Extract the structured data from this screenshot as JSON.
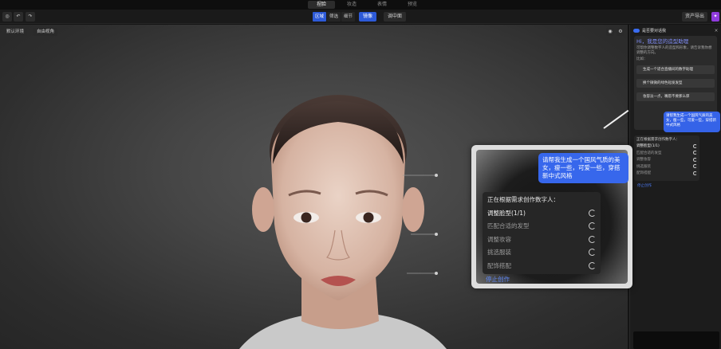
{
  "top_tabs": [
    {
      "label": "捏脸",
      "active": true
    },
    {
      "label": "妆造",
      "active": false
    },
    {
      "label": "表情",
      "active": false
    },
    {
      "label": "预览",
      "active": false
    }
  ],
  "toolbar": {
    "undo_icon": "undo-icon",
    "redo_icon": "redo-icon",
    "segments": [
      "区域",
      "筛选",
      "细节"
    ],
    "active_segment": "区域",
    "mirror_label": "镜像",
    "view_label": "调中面",
    "export_label": "资产导出",
    "accent": "#2d5ad8"
  },
  "viewport": {
    "env_label": "默认环境",
    "camera_label": "自由视角",
    "eye_icon": "eye-icon",
    "settings_icon": "gear-icon"
  },
  "chat": {
    "header": "是否要对话我",
    "greeting_title": "Hi，我是您的造型助理",
    "greeting_desc": "可帮你调整数字人的造型和形象，请告诉我你想调整的方向。",
    "examples_label": "比如：",
    "suggestions": [
      "生成一个适合直播间的数字助理",
      "换个微微的绿色短发发型",
      "妆容淡一点，嘴唇不要那么厚"
    ],
    "user_message": "请帮我生成一个国风气质的美女，瘦一些，可爱一些，穿搭新中式风格",
    "status_title": "正在根据需求创作数字人：",
    "steps": [
      "调整脸型(1/1)",
      "匹配合适的发型",
      "调整妆容",
      "挑选服装",
      "配饰搭配"
    ],
    "stop_label": "停止创作",
    "accent": "#3563e8"
  },
  "zoom": {
    "user_message": "请帮我生成一个国风气质的美女，瘦一些，可爱一些，穿搭新中式风格",
    "status_title": "正在根据需求创作数字人：",
    "steps": [
      "调整脸型(1/1)",
      "匹配合适的发型",
      "调整妆容",
      "挑选服装",
      "配饰搭配"
    ],
    "stop_label": "停止创作"
  }
}
